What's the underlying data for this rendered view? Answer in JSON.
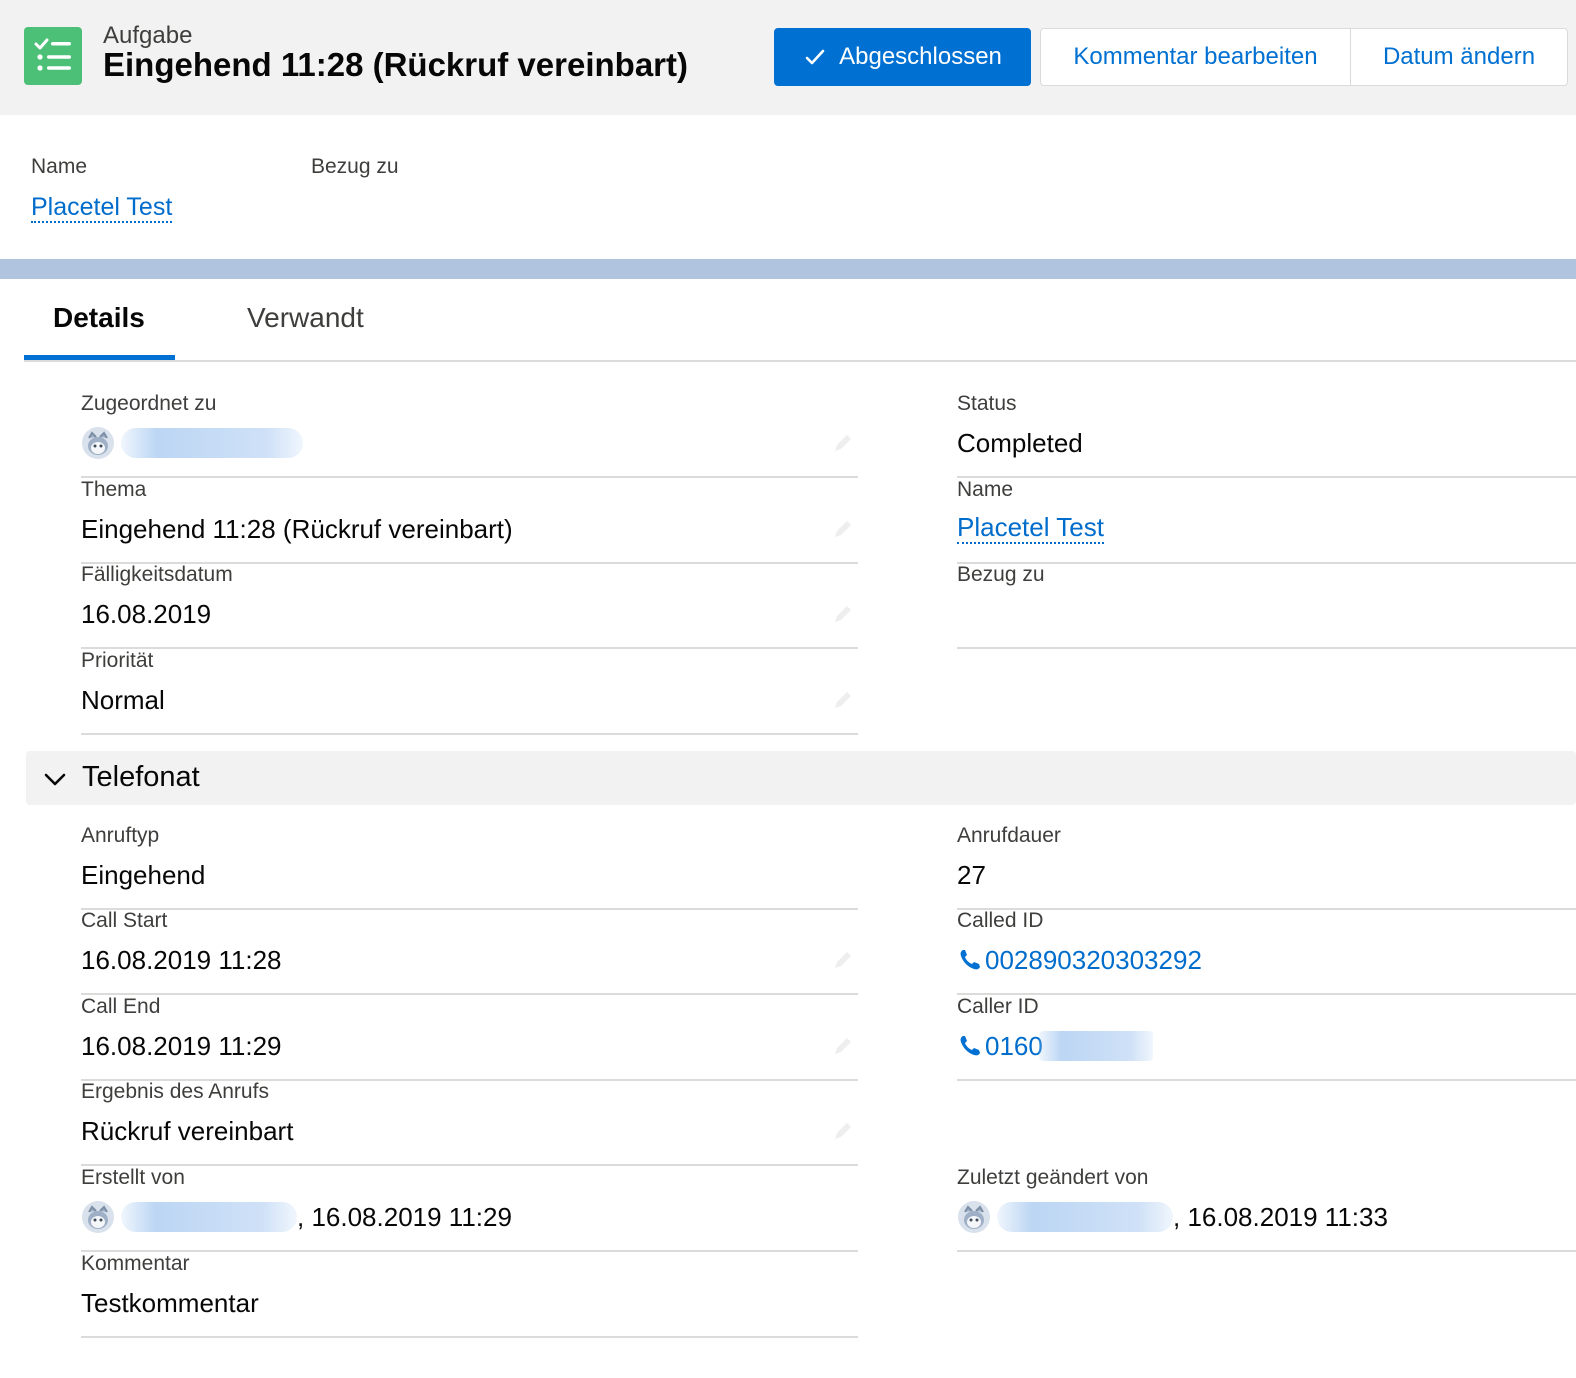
{
  "header": {
    "entity": "Aufgabe",
    "title": "Eingehend 11:28 (Rückruf vereinbart)",
    "buttons": {
      "completed": "Abgeschlossen",
      "edit_comment": "Kommentar bearbeiten",
      "change_date": "Datum ändern"
    },
    "icon": "task-list-icon",
    "accent_color": "#0070d2",
    "icon_color": "#4bc076"
  },
  "highlights": {
    "name_label": "Name",
    "name_value": "Placetel Test",
    "related_label": "Bezug zu"
  },
  "tabs": [
    {
      "label": "Details",
      "active": true
    },
    {
      "label": "Verwandt",
      "active": false
    }
  ],
  "details": {
    "assigned_label": "Zugeordnet zu",
    "subject_label": "Thema",
    "subject_value": "Eingehend 11:28 (Rückruf vereinbart)",
    "due_label": "Fälligkeitsdatum",
    "due_value": "16.08.2019",
    "priority_label": "Priorität",
    "priority_value": "Normal",
    "status_label": "Status",
    "status_value": "Completed",
    "name_label": "Name",
    "name_value": "Placetel Test",
    "related_label": "Bezug zu"
  },
  "call_section": {
    "title": "Telefonat",
    "call_type_label": "Anruftyp",
    "call_type_value": "Eingehend",
    "call_start_label": "Call Start",
    "call_start_value": "16.08.2019 11:28",
    "call_end_label": "Call End",
    "call_end_value": "16.08.2019 11:29",
    "result_label": "Ergebnis des Anrufs",
    "result_value": "Rückruf vereinbart",
    "created_label": "Erstellt von",
    "created_date": ", 16.08.2019 11:29",
    "comment_label": "Kommentar",
    "comment_value": "Testkommentar",
    "duration_label": "Anrufdauer",
    "duration_value": "27",
    "called_id_label": "Called ID",
    "called_id_value": "002890320303292",
    "caller_id_label": "Caller ID",
    "caller_id_value": "0160",
    "modified_label": "Zuletzt geändert von",
    "modified_date": ", 16.08.2019 11:33"
  }
}
